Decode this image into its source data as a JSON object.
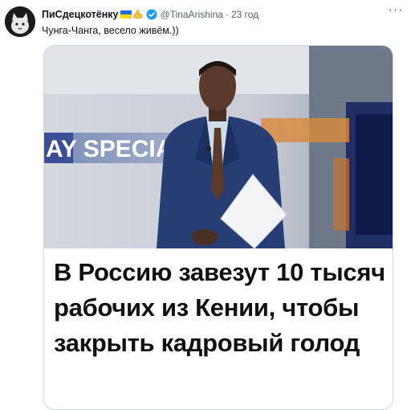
{
  "tweet": {
    "display_name": "ПиСдецкотёнку",
    "handle": "@TinaArishina",
    "separator": "·",
    "time": "23 год",
    "text": "Чунга-Чанга, весело живём.))",
    "more_label": "···"
  },
  "card": {
    "image_banner_text": "AY SPECIA",
    "headline": "В Россию завезут 10 тысяч рабочих из Кении, чтобы закрыть кадровый голод"
  },
  "colors": {
    "flag_blue": "#1d6fd1",
    "flag_yellow": "#ffd500",
    "verified_blue": "#1d9bf0",
    "suit": "#263e74"
  },
  "icons": {
    "avatar": "cat-avatar",
    "flag": "ukraine-flag-emoji",
    "muscle": "flexed-biceps-emoji",
    "verified": "verified-badge-icon",
    "more": "more-options-icon"
  }
}
